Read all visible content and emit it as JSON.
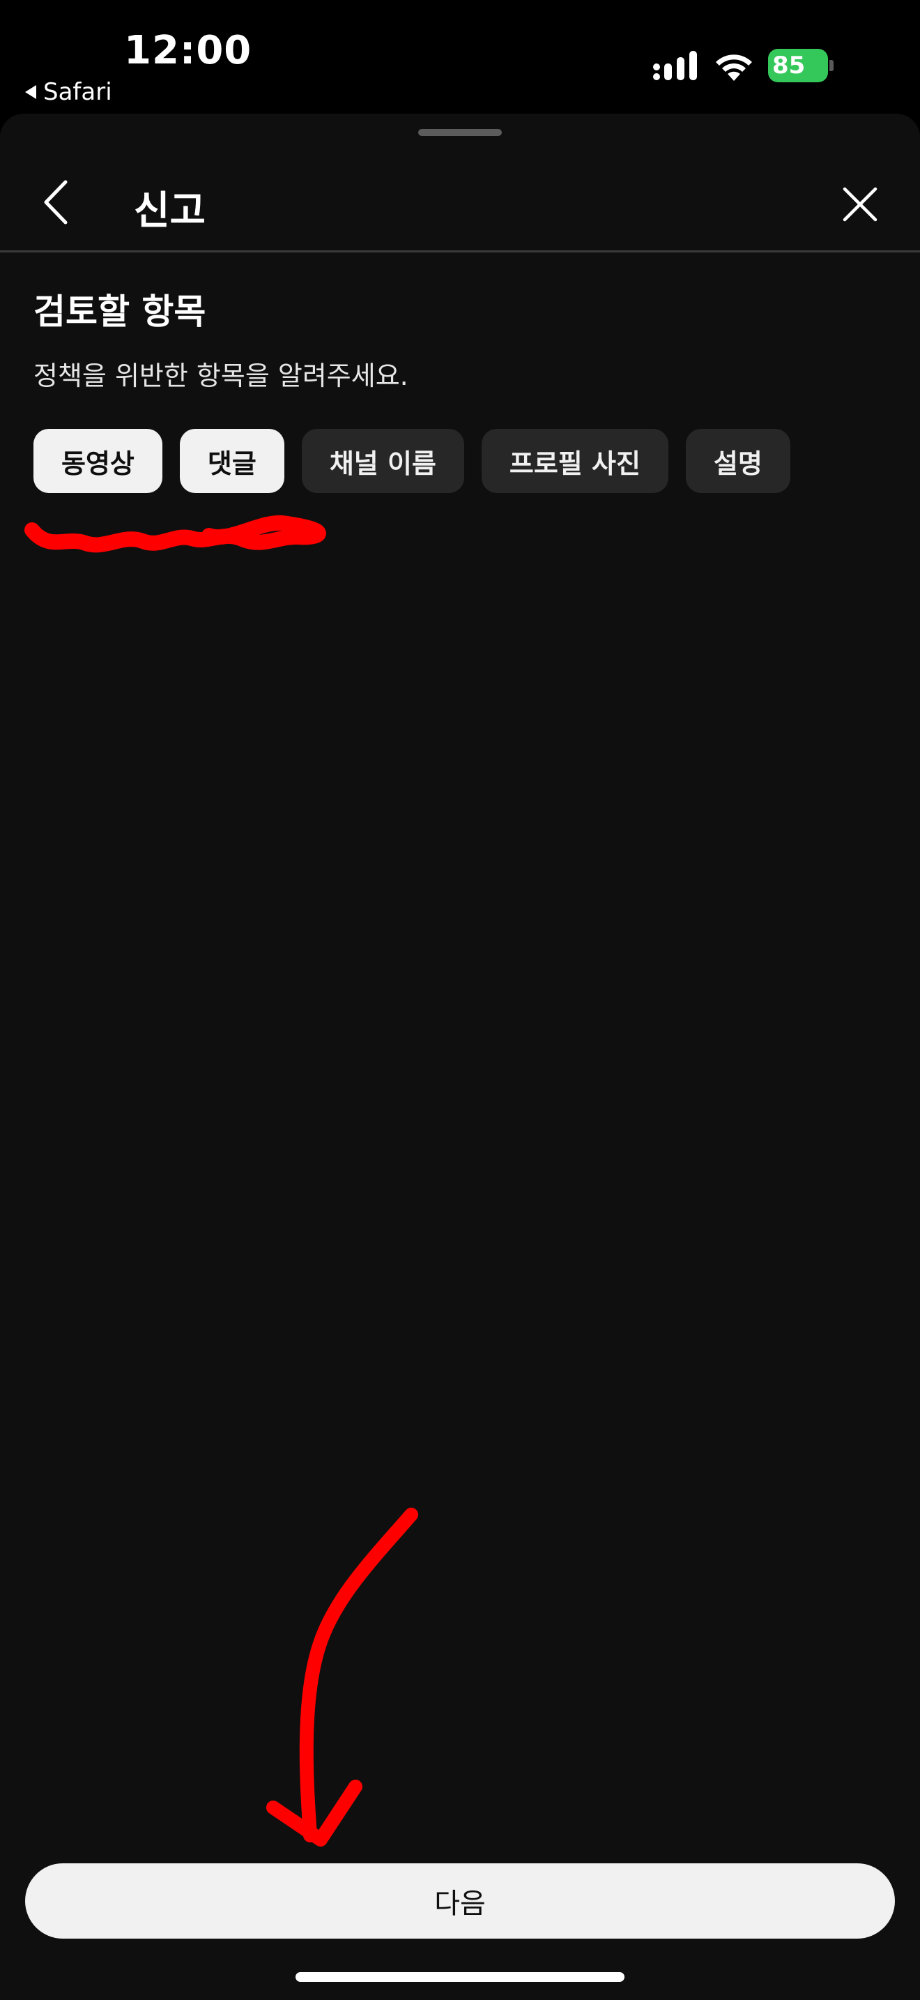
{
  "status_bar": {
    "time": "12:00",
    "back_app": "Safari",
    "battery": "85"
  },
  "sheet": {
    "title": "신고",
    "heading": "검토할 항목",
    "description": "정책을 위반한 항목을 알려주세요.",
    "chips": [
      {
        "label": "동영상",
        "selected": true
      },
      {
        "label": "댓글",
        "selected": true
      },
      {
        "label": "채널 이름",
        "selected": false
      },
      {
        "label": "프로필 사진",
        "selected": false
      },
      {
        "label": "설명",
        "selected": false
      }
    ],
    "next_label": "다음"
  },
  "colors": {
    "background": "#0f0f0f",
    "chip_selected": "#f1f1f1",
    "chip_unselected": "#272727",
    "annotation": "#ff0000",
    "battery": "#34c759"
  }
}
